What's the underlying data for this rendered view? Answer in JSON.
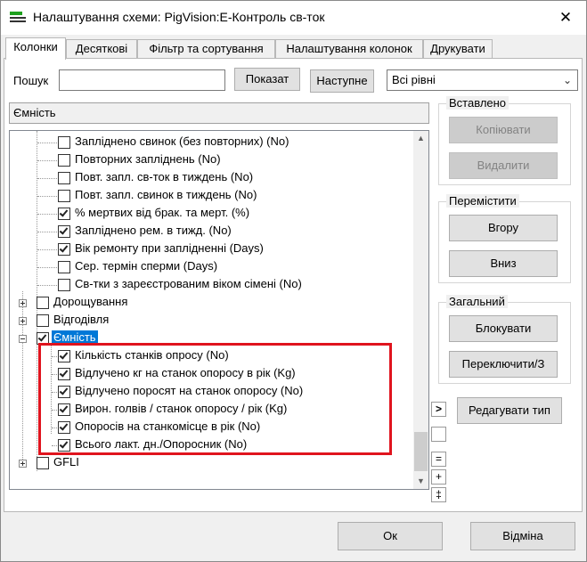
{
  "window": {
    "title": "Налаштування схеми: PigVision:E-Контроль св-ток",
    "close_glyph": "✕"
  },
  "tabs": [
    {
      "label": "Колонки"
    },
    {
      "label": "Десяткові"
    },
    {
      "label": "Фільтр та сортування"
    },
    {
      "label": "Налаштування колонок"
    },
    {
      "label": "Друкувати"
    }
  ],
  "search": {
    "label": "Пошук",
    "value": "",
    "show_label": "Показат",
    "next_label": "Наступне",
    "level_value": "Всі рівні"
  },
  "selected_field": "Ємність",
  "tree_items": [
    {
      "label": "Запліднено свинок  (без повторних) (No)",
      "checked": false
    },
    {
      "label": "Повторних запліднень (No)",
      "checked": false
    },
    {
      "label": "Повт. запл. св-ток в тиждень (No)",
      "checked": false
    },
    {
      "label": "Повт. запл. свинок в тиждень (No)",
      "checked": false
    },
    {
      "label": "% мертвих від брак. та мерт. (%)",
      "checked": true
    },
    {
      "label": "Запліднено рем. в тижд. (No)",
      "checked": true
    },
    {
      "label": "Вік ремонту при заплідненні (Days)",
      "checked": true
    },
    {
      "label": "Сер. термін сперми (Days)",
      "checked": false
    },
    {
      "label": "Св-тки з зареєстрованим віком сімені (No)",
      "checked": false
    },
    {
      "label": "Дорощування",
      "checked": false,
      "group": true
    },
    {
      "label": "Відгодівля",
      "checked": false,
      "group": true
    },
    {
      "label": "Ємність",
      "checked": true,
      "group": true,
      "selected": true
    },
    {
      "label": "Кількість станків опросу (No)",
      "checked": true
    },
    {
      "label": "Відлучено кг на станок опоросу в рік (Kg)",
      "checked": true
    },
    {
      "label": "Відлучено поросят на станок опоросу (No)",
      "checked": true
    },
    {
      "label": "Вирон. голвів / станок опоросу / рік (Kg)",
      "checked": true
    },
    {
      "label": "Опоросів на станкомісце в рік (No)",
      "checked": true
    },
    {
      "label": "Всього лакт. дн./Опоросник (No)",
      "checked": true
    },
    {
      "label": "GFLI",
      "checked": false,
      "group": true
    }
  ],
  "inserted_group": {
    "title": "Вставлено",
    "copy_label": "Копіювати",
    "delete_label": "Видалити"
  },
  "move_group": {
    "title": "Перемістити",
    "up_label": "Вгору",
    "down_label": "Вниз"
  },
  "general_group": {
    "title": "Загальний",
    "block_label": "Блокувати",
    "switch_label": "Переключити/З"
  },
  "edit_type_label": "Редагувати тип",
  "side_buttons": {
    "arrow": ">",
    "equal": "=",
    "plus": "+",
    "updown": "‡"
  },
  "footer": {
    "ok_label": "Ок",
    "cancel_label": "Відміна"
  }
}
